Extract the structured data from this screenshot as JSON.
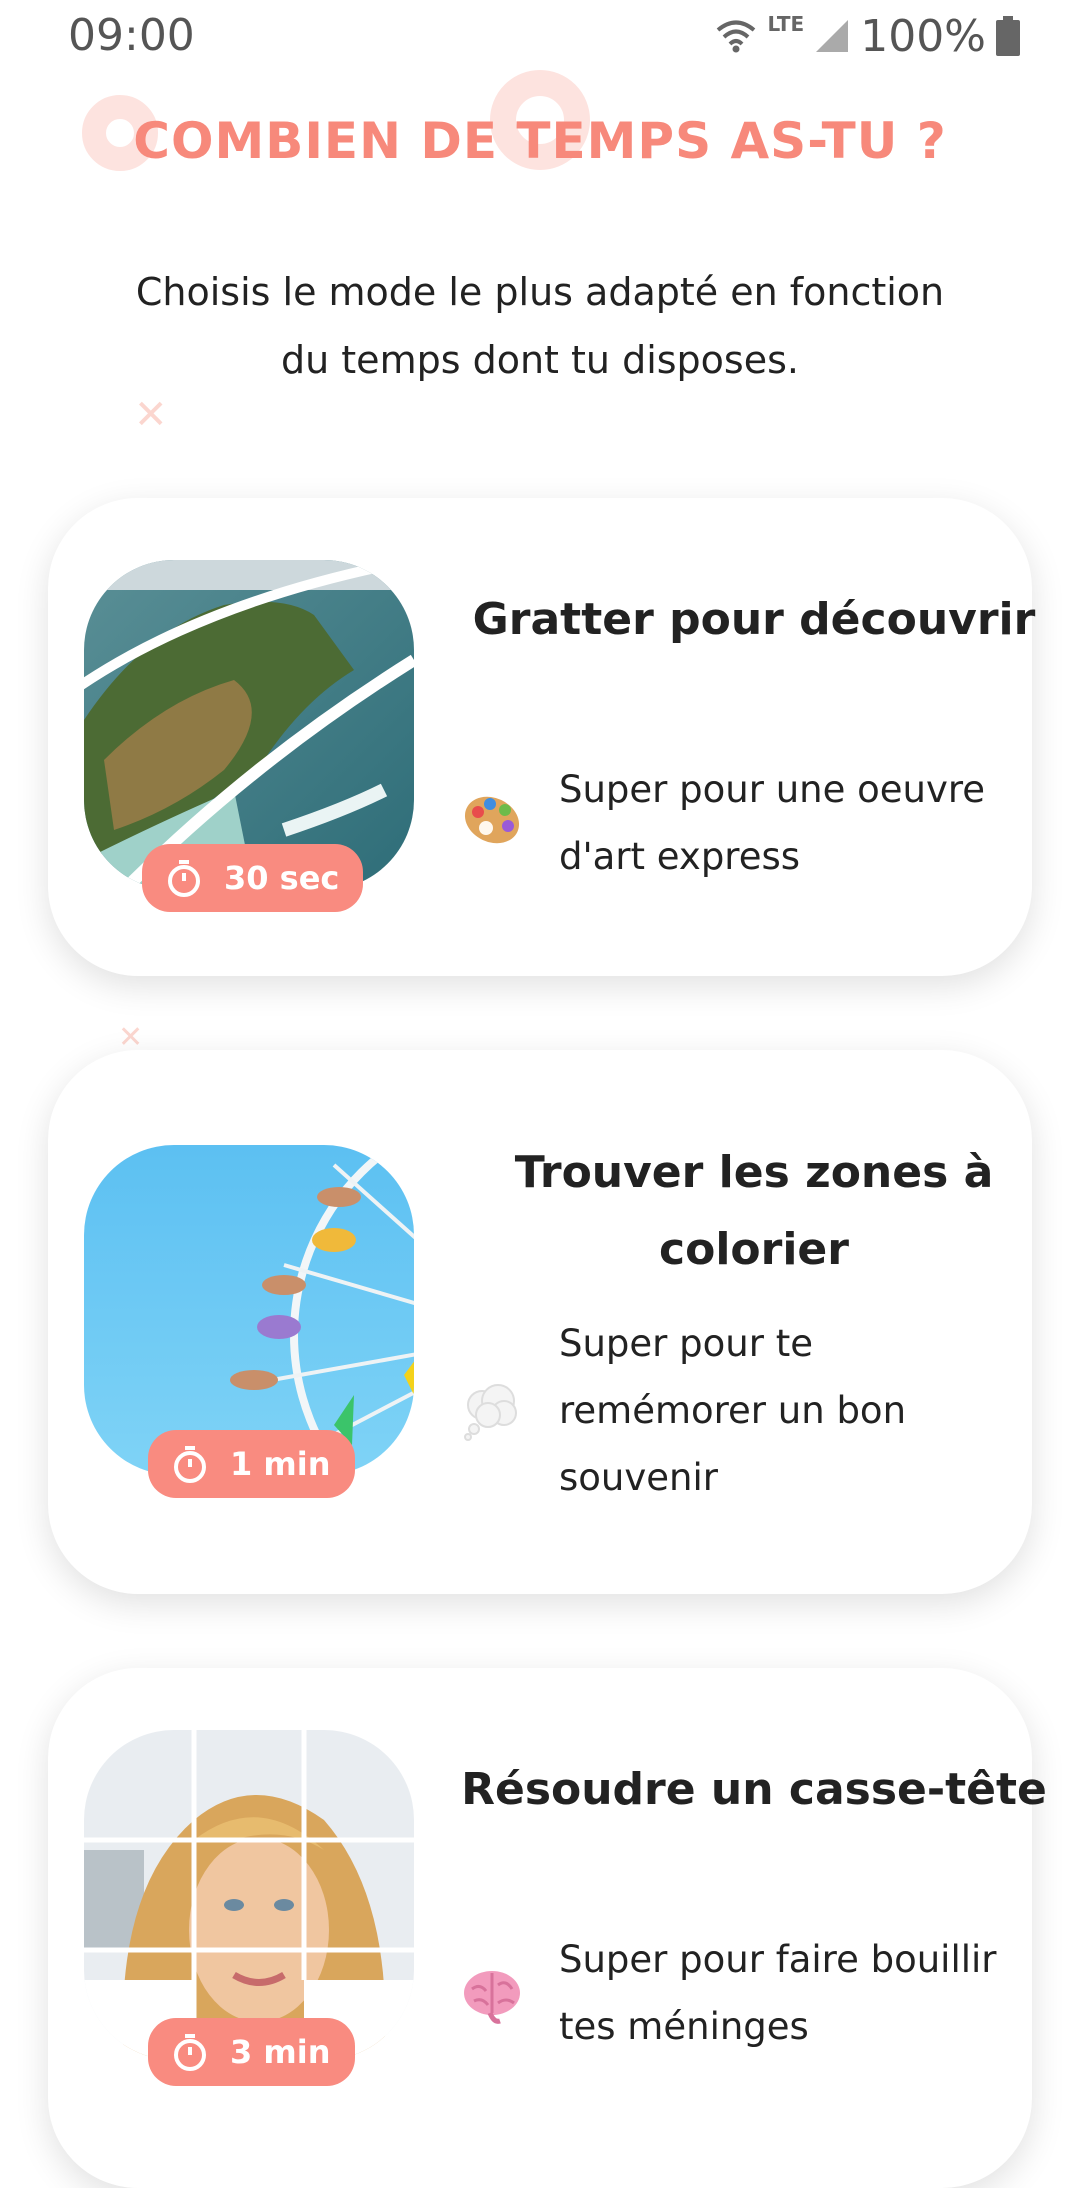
{
  "status_bar": {
    "time": "09:00",
    "network": "LTE",
    "battery": "100%",
    "icons": [
      "wifi-icon",
      "signal-icon",
      "battery-icon"
    ]
  },
  "header": {
    "title": "COMBIEN DE TEMPS AS-TU ?",
    "subtitle": "Choisis le mode le plus adapté en fonction du temps dont tu disposes."
  },
  "modes": [
    {
      "title": "Gratter pour découvrir",
      "duration": "30 sec",
      "emoji": "palette",
      "description": "Super pour une oeuvre d'art express",
      "image": "coastal-cliff-landscape"
    },
    {
      "title": "Trouver les zones à colorier",
      "duration": "1 min",
      "emoji": "thought-bubble",
      "description": "Super pour te remémorer un bon souvenir",
      "image": "ferris-wheel-sky"
    },
    {
      "title": "Résoudre un casse-tête",
      "duration": "3 min",
      "emoji": "brain",
      "description": "Super pour faire bouillir tes méninges",
      "image": "portrait-puzzle"
    }
  ],
  "colors": {
    "accent": "#f7897b",
    "badge": "#f98b80",
    "text": "#222222",
    "background": "#ffffff"
  }
}
